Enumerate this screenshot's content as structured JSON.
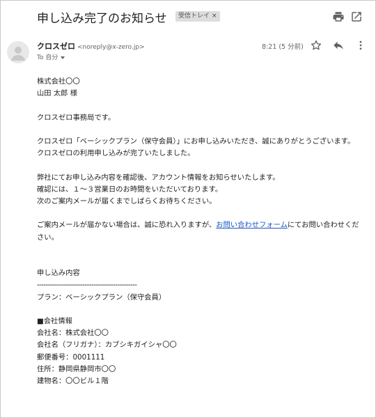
{
  "header": {
    "subject": "申し込み完了のお知らせ",
    "label": "受信トレイ",
    "label_close": "×"
  },
  "sender": {
    "name": "クロスゼロ",
    "email": "<noreply@x-zero.jp>",
    "to_prefix": "To",
    "to_name": "自分",
    "timestamp": "8:21 (5 分前)"
  },
  "body": {
    "lines": [
      "株式会社〇〇",
      "山田 太郎 様",
      "クロスゼロ事務局です。",
      "クロスゼロ「ベーシックプラン（保守会員）」にお申し込みいただき、誠にありがとうございます。",
      "クロスゼロの利用申し込みが完了いたしました。",
      "弊社にてお申し込み内容を確認後、アカウント情報をお知らせいたします。",
      "確認には、１～３営業日のお時間をいただいております。",
      "次のご案内メールが届くまでしばらくお待ちください。",
      "ご案内メールが届かない場合は、誠に恐れ入りますが、",
      "お問い合わせフォーム",
      "にてお問い合わせください。",
      "申し込み内容",
      "----------------------------------------------",
      "プラン：ベーシックプラン（保守会員）",
      "■会社情報",
      "会社名：株式会社〇〇",
      "会社名（フリガナ）：カブシキガイシャ〇〇",
      "郵便番号：0001111",
      "住所：静岡県静岡市〇〇",
      "建物名：〇〇ビル１階"
    ]
  },
  "icons": {
    "print": "print-icon",
    "new_window": "open-in-new-window-icon",
    "star": "star-icon",
    "reply": "reply-icon",
    "more": "more-vertical-icon",
    "avatar": "avatar-icon"
  }
}
